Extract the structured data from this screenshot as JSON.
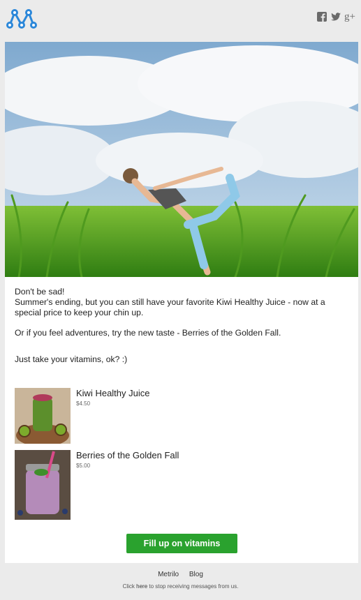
{
  "social": {
    "icons": [
      "facebook-icon",
      "twitter-icon",
      "google-plus-icon"
    ],
    "gplus_text": "g+"
  },
  "message": {
    "line1": "Don't be sad!",
    "line2": "Summer's ending, but you can still have your favorite Kiwi Healthy Juice - now at a special price to keep your chin up.",
    "line3": "Or if you feel adventures, try the new taste - Berries of the Golden Fall.",
    "line4": "Just take your vitamins, ok? :)"
  },
  "products": [
    {
      "name": "Kiwi Healthy Juice",
      "price": "$4.50"
    },
    {
      "name": "Berries of the Golden Fall",
      "price": "$5.00"
    }
  ],
  "cta": {
    "label": "Fill up on vitamins"
  },
  "footer": {
    "links": [
      "Metrilo",
      "Blog"
    ],
    "unsub_pre": "Click ",
    "unsub_link": "here",
    "unsub_post": " to stop receiving messages from us."
  },
  "colors": {
    "accent": "#2aa22e",
    "logo": "#2b87d9",
    "background": "#ebebeb"
  }
}
